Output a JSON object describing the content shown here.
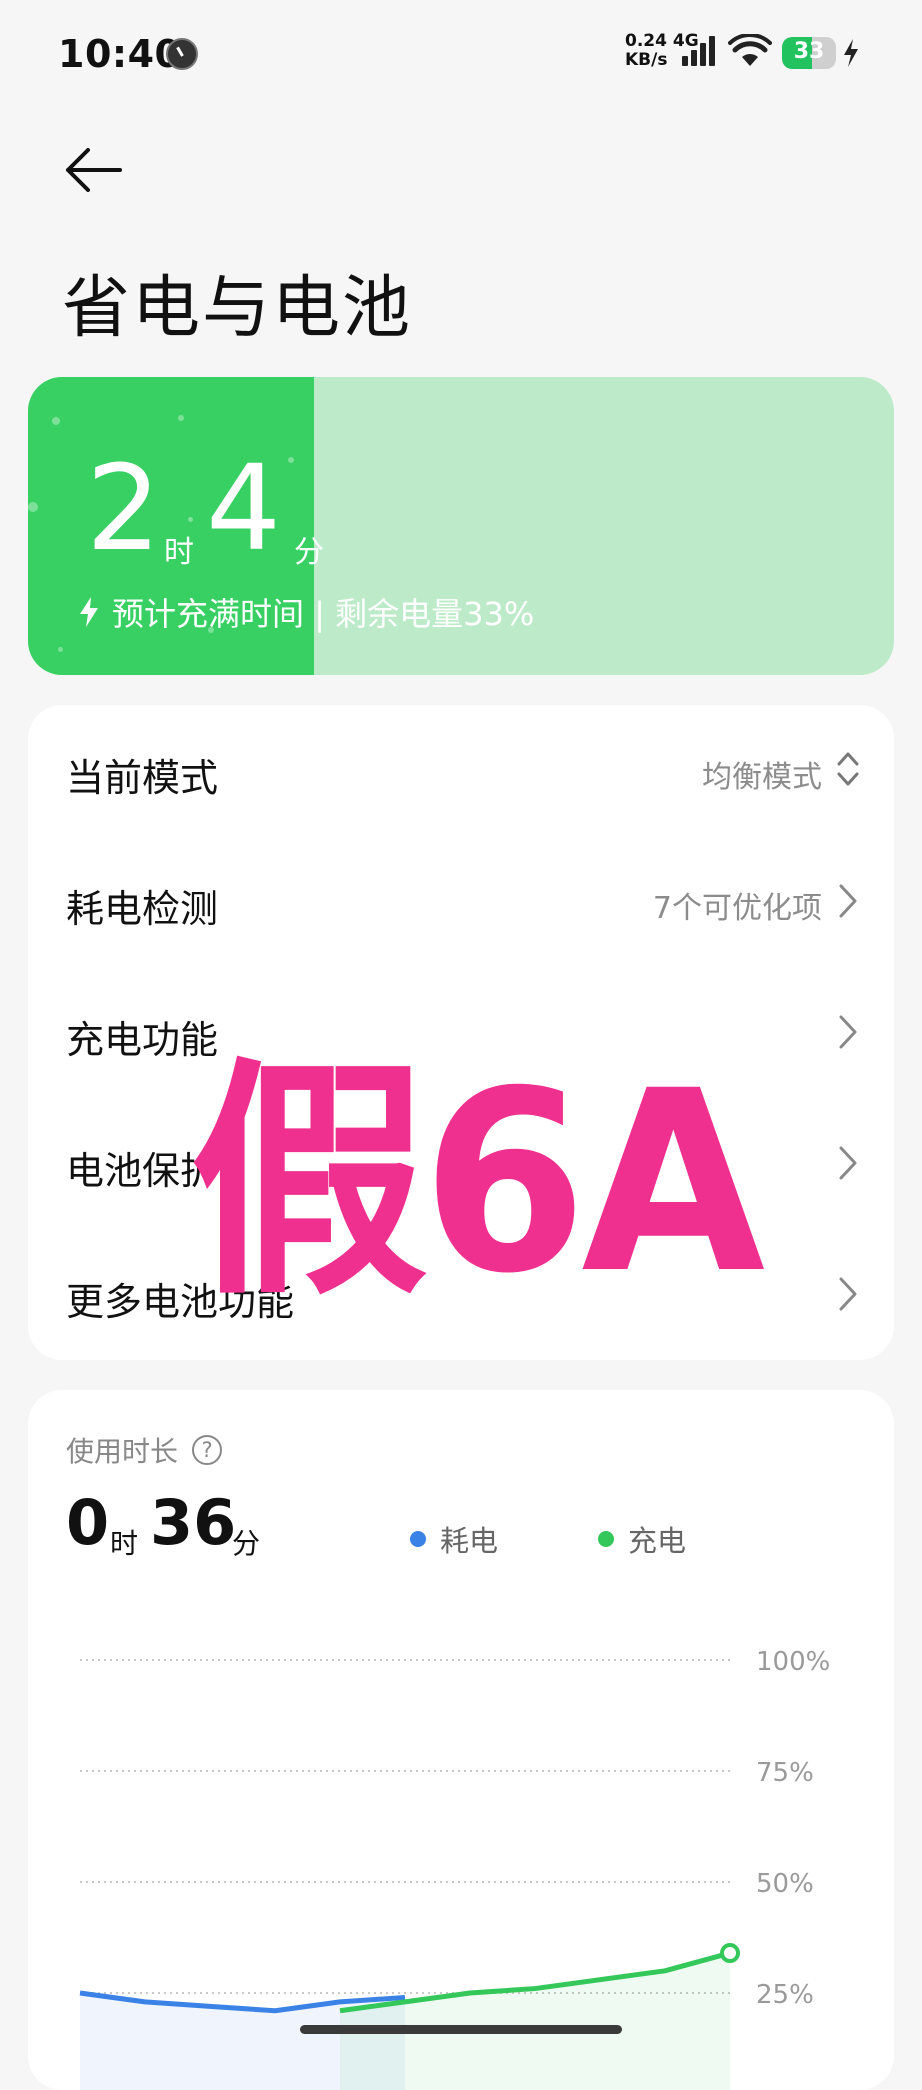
{
  "status": {
    "time": "10:40",
    "speed_value": "0.24",
    "network": "4G",
    "speed_unit": "KB/s",
    "battery": "33"
  },
  "header": {
    "title": "省电与电池"
  },
  "battery_card": {
    "hours": "2",
    "hours_unit": "时",
    "minutes": "4",
    "minutes_unit": "分",
    "subtitle": "预计充满时间 | 剩余电量33%",
    "level_percent": 33,
    "accent": "#38d063"
  },
  "settings": [
    {
      "label": "当前模式",
      "value": "均衡模式",
      "control": "updown"
    },
    {
      "label": "耗电检测",
      "value": "7个可优化项",
      "control": "chevron"
    },
    {
      "label": "充电功能",
      "value": "",
      "control": "chevron"
    },
    {
      "label": "电池保护",
      "value": "",
      "control": "chevron"
    },
    {
      "label": "更多电池功能",
      "value": "",
      "control": "chevron"
    }
  ],
  "watermark": "假6A",
  "usage": {
    "label": "使用时长",
    "hours": "0",
    "hours_unit": "时",
    "minutes": "36",
    "minutes_unit": "分",
    "legend": [
      {
        "name": "耗电",
        "color": "#3b82e6"
      },
      {
        "name": "充电",
        "color": "#34c759"
      }
    ]
  },
  "chart_data": {
    "type": "line",
    "y_ticks": [
      "100%",
      "75%",
      "50%",
      "25%"
    ],
    "ylim": [
      0,
      100
    ],
    "grid": true,
    "x": [
      0,
      1,
      2,
      3,
      4,
      5,
      6,
      7,
      8,
      9,
      10
    ],
    "series": [
      {
        "name": "耗电",
        "color": "#3b82e6",
        "x": [
          0,
          1,
          2,
          3,
          4,
          5
        ],
        "values": [
          25,
          23,
          22,
          21,
          23,
          24
        ]
      },
      {
        "name": "充电",
        "color": "#34c759",
        "x": [
          4,
          5,
          6,
          7,
          8,
          9,
          10
        ],
        "values": [
          21,
          23,
          25,
          26,
          28,
          30,
          34
        ]
      }
    ]
  }
}
